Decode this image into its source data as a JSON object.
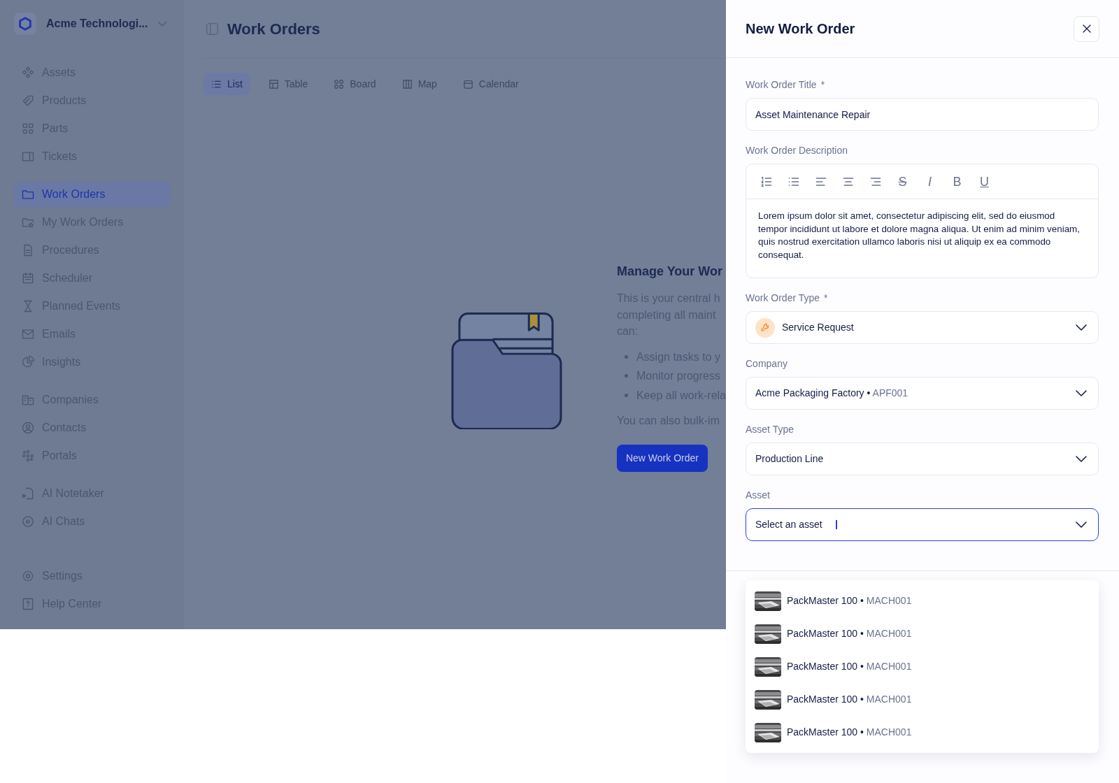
{
  "app": {
    "company": "Acme Technologi...",
    "sidebar": {
      "groups": [
        {
          "items": [
            {
              "label": "Assets",
              "selected": false
            },
            {
              "label": "Products",
              "selected": false
            },
            {
              "label": "Parts",
              "selected": false
            },
            {
              "label": "Tickets",
              "selected": false
            }
          ]
        },
        {
          "items": [
            {
              "label": "Work Orders",
              "selected": true
            },
            {
              "label": "My Work Orders",
              "selected": false
            },
            {
              "label": "Procedures",
              "selected": false
            },
            {
              "label": "Scheduler",
              "selected": false
            },
            {
              "label": "Planned Events",
              "selected": false
            },
            {
              "label": "Emails",
              "selected": false
            },
            {
              "label": "Insights",
              "selected": false
            }
          ]
        },
        {
          "items": [
            {
              "label": "Companies",
              "selected": false
            },
            {
              "label": "Contacts",
              "selected": false
            },
            {
              "label": "Portals",
              "selected": false
            }
          ]
        },
        {
          "items": [
            {
              "label": "AI Notetaker",
              "selected": false
            },
            {
              "label": "AI Chats",
              "selected": false
            }
          ]
        }
      ],
      "footer": [
        {
          "label": "Settings",
          "selected": false
        },
        {
          "label": "Help Center",
          "selected": false
        }
      ]
    },
    "page_title": "Work Orders",
    "view_tabs": [
      {
        "label": "List",
        "selected": true
      },
      {
        "label": "Table",
        "selected": false
      },
      {
        "label": "Board",
        "selected": false
      },
      {
        "label": "Map",
        "selected": false
      },
      {
        "label": "Calendar",
        "selected": false
      }
    ],
    "empty_state": {
      "heading": "Manage Your Wor",
      "paragraph_lines": [
        "This is your central h",
        "completing all maint",
        "can:"
      ],
      "bullets": [
        "Assign tasks to y",
        "Monitor progress",
        "Keep all work-rela"
      ],
      "note": "You can also bulk-im",
      "button": "New Work Order"
    }
  },
  "panel": {
    "title": "New Work Order",
    "fields": [
      {
        "kind": "text",
        "label": "Work Order Title",
        "required_mark": "*",
        "value": "Asset Maintenance Repair"
      },
      {
        "kind": "editor",
        "label": "Work Order Description",
        "toolbar": [
          {
            "kind": "numbered-list"
          },
          {
            "kind": "bullet-list"
          },
          {
            "kind": "align-left"
          },
          {
            "kind": "align-center"
          },
          {
            "kind": "align-right"
          },
          {
            "kind": "strikethrough",
            "glyph": "S"
          },
          {
            "kind": "italic",
            "glyph": "I"
          },
          {
            "kind": "bold",
            "glyph": "B"
          },
          {
            "kind": "underline",
            "glyph": "U"
          }
        ],
        "value": "Lorem ipsum dolor sit amet, consectetur adipiscing elit, sed do eiusmod tempor incididunt ut labore et dolore magna aliqua. Ut enim ad minim veniam, quis nostrud exercitation ullamco laboris nisi ut aliquip ex ea commodo consequat."
      },
      {
        "kind": "select-icon",
        "label": "Work Order Type",
        "required_mark": "*",
        "value": "Service Request",
        "focused": false
      },
      {
        "kind": "select",
        "label": "Company",
        "value": "Acme Packaging Factory",
        "separator": "•",
        "secondary": "APF001",
        "focused": false
      },
      {
        "kind": "select",
        "label": "Asset Type",
        "value": "Production Line",
        "focused": false
      },
      {
        "kind": "select",
        "label": "Asset",
        "placeholder": "Select an asset",
        "focused": true
      }
    ],
    "options": [
      {
        "name": "PackMaster 100",
        "separator": "•",
        "code": "MACH001"
      },
      {
        "name": "PackMaster 100",
        "separator": "•",
        "code": "MACH001"
      },
      {
        "name": "PackMaster 100",
        "separator": "•",
        "code": "MACH001"
      },
      {
        "name": "PackMaster 100",
        "separator": "•",
        "code": "MACH001"
      },
      {
        "name": "PackMaster 100",
        "separator": "•",
        "code": "MACH001"
      }
    ]
  }
}
